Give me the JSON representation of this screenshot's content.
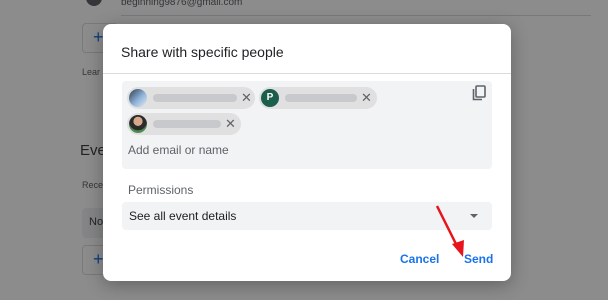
{
  "background": {
    "email": "beginning9876@gmail.com",
    "learn_text": "Lear",
    "section_title": "Eve",
    "recent_text": "Rece",
    "select_text": "No"
  },
  "dialog": {
    "title": "Share with specific people",
    "recipients": [
      {
        "avatar": "photo",
        "initial": "",
        "name_hidden": true
      },
      {
        "avatar": "letter",
        "initial": "P",
        "name_hidden": true
      },
      {
        "avatar": "photo",
        "initial": "",
        "name_hidden": true
      }
    ],
    "input_placeholder": "Add email or name",
    "permissions_label": "Permissions",
    "permissions_value": "See all event details",
    "cancel_label": "Cancel",
    "send_label": "Send",
    "colors": {
      "accent": "#1a73e8",
      "field_bg": "#f1f3f4",
      "annotation_arrow": "#e8141c",
      "letter_avatar": "#1b5e4b"
    },
    "icons": [
      "copy-icon",
      "close-icon",
      "dropdown-caret-icon",
      "red-arrow-annotation"
    ]
  }
}
